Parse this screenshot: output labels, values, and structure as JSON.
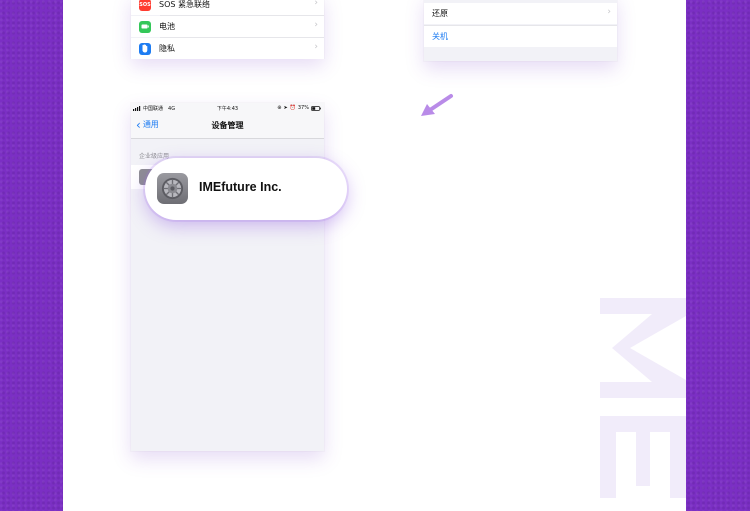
{
  "settings_card": {
    "rows": [
      {
        "label": "SOS 紧急联络",
        "icon": "sos-icon",
        "icon_text": "SOS",
        "color": "#ff3b30"
      },
      {
        "label": "电池",
        "icon": "battery-icon",
        "color": "#34c759"
      },
      {
        "label": "隐私",
        "icon": "hand-icon",
        "color": "#1e7cf2"
      }
    ]
  },
  "general_card": {
    "reset_label": "还原",
    "shutdown_label": "关机",
    "link_color": "#1e7cf2"
  },
  "phone": {
    "status": {
      "carrier": "中国联通",
      "network": "4G",
      "time": "下午4:43",
      "battery": "37%"
    },
    "back_label": "通用",
    "title": "设备管理",
    "section_header": "企业级应用"
  },
  "callout": {
    "app_name": "IMEfuture Inc.",
    "icon": "settings-gear-icon"
  },
  "watermark": "IME",
  "colors": {
    "background": "#7b2fc4",
    "accent_arrow": "#b98be8"
  }
}
